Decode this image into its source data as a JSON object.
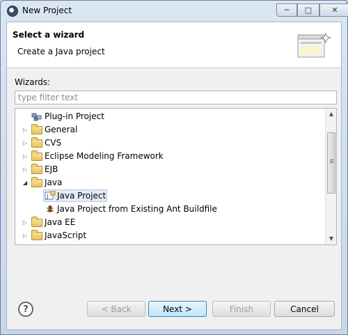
{
  "window": {
    "title": "New Project"
  },
  "header": {
    "title": "Select a wizard",
    "description": "Create a Java project"
  },
  "filter": {
    "label": "Wizards:",
    "placeholder": "type filter text",
    "value": ""
  },
  "tree": {
    "items": [
      {
        "label": "Plug-in Project",
        "icon": "plugin-icon",
        "level": 1,
        "expandable": false
      },
      {
        "label": "General",
        "icon": "folder-icon",
        "level": 0,
        "expandable": true,
        "expanded": false
      },
      {
        "label": "CVS",
        "icon": "folder-icon",
        "level": 0,
        "expandable": true,
        "expanded": false
      },
      {
        "label": "Eclipse Modeling Framework",
        "icon": "folder-icon",
        "level": 0,
        "expandable": true,
        "expanded": false
      },
      {
        "label": "EJB",
        "icon": "folder-icon",
        "level": 0,
        "expandable": true,
        "expanded": false
      },
      {
        "label": "Java",
        "icon": "folder-icon",
        "level": 0,
        "expandable": true,
        "expanded": true
      },
      {
        "label": "Java Project",
        "icon": "java-project-icon",
        "level": 1,
        "expandable": false,
        "selected": true
      },
      {
        "label": "Java Project from Existing Ant Buildfile",
        "icon": "ant-icon",
        "level": 1,
        "expandable": false
      },
      {
        "label": "Java EE",
        "icon": "folder-icon",
        "level": 0,
        "expandable": true,
        "expanded": false
      },
      {
        "label": "JavaScript",
        "icon": "folder-icon",
        "level": 0,
        "expandable": true,
        "expanded": false
      }
    ]
  },
  "buttons": {
    "help": "?",
    "back": "< Back",
    "next": "Next >",
    "finish": "Finish",
    "cancel": "Cancel"
  },
  "colors": {
    "selection_bg": "#e3ecf7",
    "default_button": "#bee6fd"
  }
}
